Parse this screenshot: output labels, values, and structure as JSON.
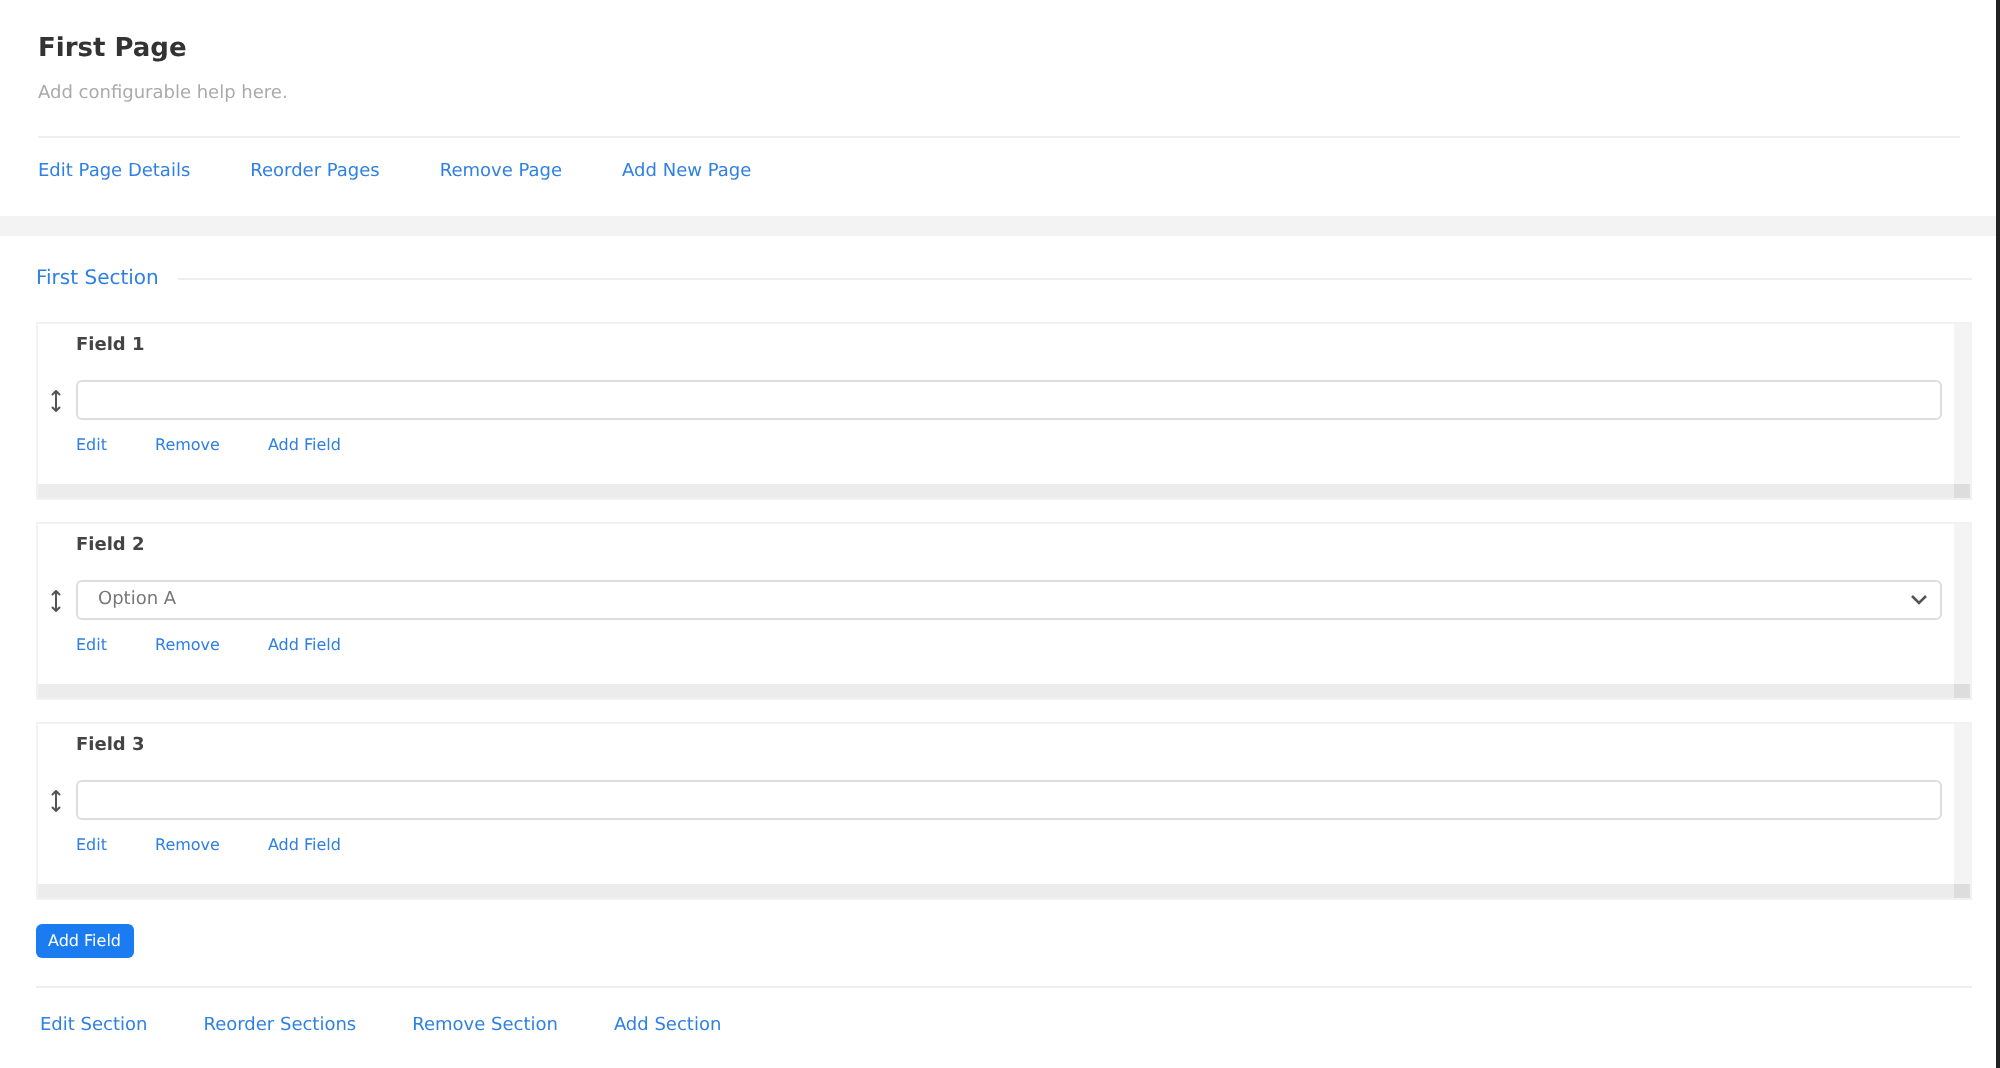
{
  "page": {
    "title": "First Page",
    "help": "Add configurable help here.",
    "actions": [
      "Edit Page Details",
      "Reorder Pages",
      "Remove Page",
      "Add New Page"
    ]
  },
  "section": {
    "title": "First Section",
    "fields": [
      {
        "label": "Field 1",
        "kind": "text",
        "actions": [
          "Edit",
          "Remove",
          "Add Field"
        ]
      },
      {
        "label": "Field 2",
        "kind": "select",
        "value": "Option A",
        "actions": [
          "Edit",
          "Remove",
          "Add Field"
        ]
      },
      {
        "label": "Field 3",
        "kind": "text",
        "actions": [
          "Edit",
          "Remove",
          "Add Field"
        ]
      }
    ],
    "add_button": "Add Field",
    "actions": [
      "Edit Section",
      "Reorder Sections",
      "Remove Section",
      "Add Section"
    ]
  }
}
